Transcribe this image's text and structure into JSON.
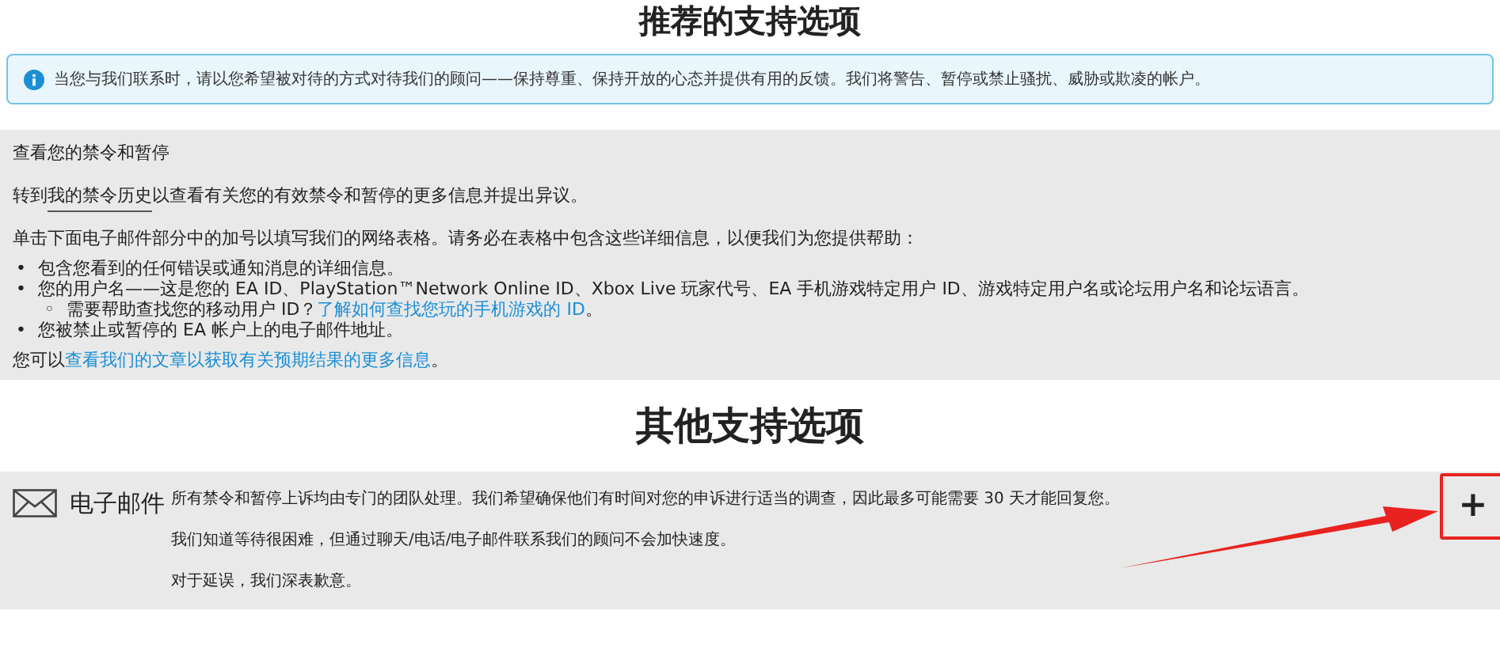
{
  "top_heading": "推荐的支持选项",
  "notice": {
    "text": "当您与我们联系时，请以您希望被对待的方式对待我们的顾问——保持尊重、保持开放的心态并提供有用的反馈。我们将警告、暂停或禁止骚扰、威胁或欺凌的帐户。"
  },
  "bans_panel": {
    "title": "查看您的禁令和暂停",
    "history_line": {
      "before": "转到",
      "link": "我的禁令历史",
      "after": "以查看有关您的有效禁令和暂停的更多信息并提出异议。"
    },
    "instructions": "单击下面电子邮件部分中的加号以填写我们的网络表格。请务必在表格中包含这些详细信息，以便我们为您提供帮助：",
    "bullets": [
      {
        "marker": "•",
        "text": "包含您看到的任何错误或通知消息的详细信息。"
      },
      {
        "marker": "•",
        "text": "您的用户名——这是您的 EA ID、PlayStation™Network Online ID、Xbox Live 玩家代号、EA 手机游戏特定用户 ID、游戏特定用户名或论坛用户名和论坛语言。",
        "children": [
          {
            "marker": "◦",
            "text": "需要帮助查找您的移动用户 ID？",
            "link": "了解如何查找您玩的手机游戏的 ID",
            "after": "。"
          }
        ]
      },
      {
        "marker": "•",
        "text": "您被禁止或暂停的 EA 帐户上的电子邮件地址。"
      }
    ],
    "article_line": {
      "before": "您可以",
      "link": "查看我们的文章以获取有关预期结果的更多信息",
      "after": "。"
    }
  },
  "other_heading": "其他支持选项",
  "email_option": {
    "label": "电子邮件",
    "expanded": false,
    "paragraphs": [
      "所有禁令和暂停上诉均由专门的团队处理。我们希望确保他们有时间对您的申诉进行适当的调查，因此最多可能需要 30 天才能回复您。",
      "我们知道等待很困难，但通过聊天/电话/电子邮件联系我们的顾问不会加快速度。",
      "对于延误，我们深表歉意。"
    ],
    "toggle": "+"
  }
}
